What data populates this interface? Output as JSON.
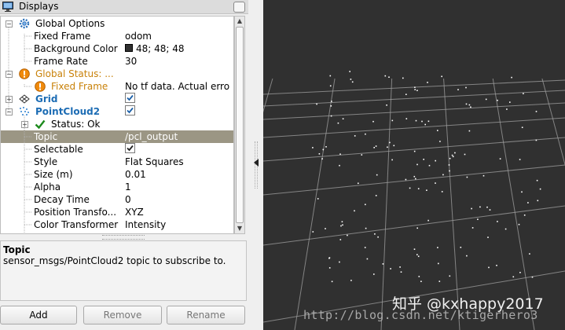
{
  "panel": {
    "title": "Displays",
    "title_icon": "monitor-icon"
  },
  "tree": {
    "global_options": {
      "label": "Global Options",
      "fixed_frame": {
        "label": "Fixed Frame",
        "value": "odom"
      },
      "background_color": {
        "label": "Background Color",
        "value": "48; 48; 48",
        "swatch": "#303030"
      },
      "frame_rate": {
        "label": "Frame Rate",
        "value": "30"
      }
    },
    "global_status": {
      "label": "Global Status: ...",
      "fixed_frame": {
        "label": "Fixed Frame",
        "value": "No tf data.  Actual erro"
      },
      "color": "#c9820a"
    },
    "grid": {
      "label": "Grid",
      "checked": true
    },
    "pointcloud2": {
      "label": "PointCloud2",
      "checked": true,
      "status": {
        "label": "Status: Ok"
      },
      "topic": {
        "label": "Topic",
        "value": "/pcl_output"
      },
      "selectable": {
        "label": "Selectable",
        "checked": true
      },
      "style": {
        "label": "Style",
        "value": "Flat Squares"
      },
      "size": {
        "label": "Size (m)",
        "value": "0.01"
      },
      "alpha": {
        "label": "Alpha",
        "value": "1"
      },
      "decay_time": {
        "label": "Decay Time",
        "value": "0"
      },
      "position_transformer": {
        "label": "Position Transfo...",
        "value": "XYZ"
      },
      "color_transformer": {
        "label": "Color Transformer",
        "value": "Intensity"
      }
    }
  },
  "description": {
    "title": "Topic",
    "text": "sensor_msgs/PointCloud2 topic to subscribe to."
  },
  "buttons": {
    "add": "Add",
    "remove": "Remove",
    "rename": "Rename"
  },
  "viewport": {
    "background": "#303030",
    "grid_color": "#a0a0a0"
  },
  "watermark": {
    "zhihu": "知乎 @kxhappy2017",
    "url": "http://blog.csdn.net/ktigerhero3"
  }
}
